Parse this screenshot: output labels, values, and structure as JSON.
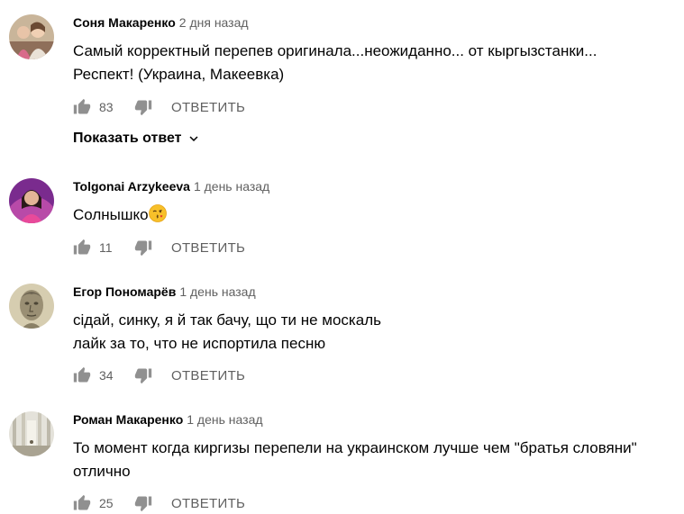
{
  "comments": [
    {
      "author": "Соня Макаренко",
      "time": "2 дня назад",
      "lines": [
        "Самый корректный перепев оригинала...неожиданно... от кыргызстанки...",
        "Респект! (Украина, Макеевка)"
      ],
      "likes": "83",
      "reply_label": "ОТВЕТИТЬ",
      "show_replies_label": "Показать ответ",
      "avatar_icon": "avatar-photo-group"
    },
    {
      "author": "Tolgonai Arzykeeva",
      "time": "1 день назад",
      "lines": [
        "Солнышко"
      ],
      "emoji": "kiss-face-emoji",
      "likes": "11",
      "reply_label": "ОТВЕТИТЬ",
      "avatar_icon": "avatar-photo-woman"
    },
    {
      "author": "Егор Пономарёв",
      "time": "1 день назад",
      "lines": [
        "сідай, синку, я й так бачу, що ти не москаль",
        "лайк за то, что не испортила песню"
      ],
      "likes": "34",
      "reply_label": "ОТВЕТИТЬ",
      "avatar_icon": "avatar-photo-statue"
    },
    {
      "author": "Роман Макаренко",
      "time": "1 день назад",
      "lines": [
        "То момент когда киргизы перепели на украинском лучше чем \"братья словяни\"",
        "отлично"
      ],
      "likes": "25",
      "reply_label": "ОТВЕТИТЬ",
      "avatar_icon": "avatar-photo-hallway"
    }
  ],
  "colors": {
    "text": "#030303",
    "secondary": "#606060",
    "icon": "#909090"
  }
}
